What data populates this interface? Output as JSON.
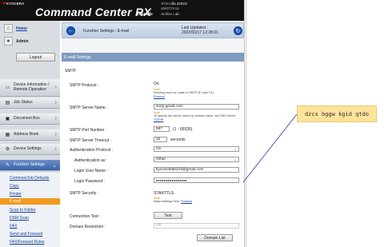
{
  "brand": {
    "name": "KYOCERA",
    "app": "Command Center RX",
    "series": "TASKalfa"
  },
  "device": {
    "model_label": "Model :",
    "model": "TASKalfa 3252ci",
    "host_label": "Host Name :",
    "host": "KM27C616",
    "location_label": "Location :",
    "location": "Hotline Lab"
  },
  "sidebar": {
    "home": "Home",
    "admin": "Admin",
    "logout": "Logout",
    "items": [
      {
        "label": "Device Information / Remote Operation"
      },
      {
        "label": "Job Status"
      },
      {
        "label": "Document Box"
      },
      {
        "label": "Address Book"
      },
      {
        "label": "Device Settings"
      },
      {
        "label": "Function Settings"
      }
    ],
    "sub": [
      "Common/Job Defaults",
      "Copy",
      "Printer",
      "E-mail",
      "Scan to Folder",
      "DSM Scan",
      "FAX",
      "Send and Forward",
      "FAX/Forward Rules"
    ]
  },
  "header": {
    "title": "Function Settings : E-mail",
    "updated_label": "Last Updated :",
    "updated": "2022/03/17 12:28:01"
  },
  "section": "E-mail Settings",
  "form": {
    "group": "SMTP",
    "smtp_protocol": {
      "label": "SMTP Protocol :",
      "value": "On",
      "note_tag": "Note",
      "note": "Sending must be made in SMTP (E-mail TX).",
      "note_link": "Protocol"
    },
    "server_name": {
      "label": "SMTP Server Name :",
      "value": "smtp.gmail.com",
      "note_tag": "Note",
      "note": "To specify the server name by domain name, set DNS server.",
      "note_link": "TCP/IP"
    },
    "port": {
      "label": "SMTP Port Number :",
      "value": "587",
      "range": "(1 - 65535)"
    },
    "timeout": {
      "label": "SMTP Server Timeout :",
      "value": "10",
      "unit": "seconds"
    },
    "auth_protocol": {
      "label": "Authentication Protocol :",
      "value": "On"
    },
    "auth_as": {
      "label": "Authentication as :",
      "value": "Other"
    },
    "login_user": {
      "label": "Login User Name :",
      "value": "kyocerafabt123@gmail.com"
    },
    "login_password": {
      "label": "Login Password :",
      "value": "●●●●●●●●●●●●●●●●"
    },
    "security": {
      "label": "SMTP Security :",
      "value": "STARTTLS",
      "note_tag": "Note",
      "note": "Make settings here.",
      "note_link": "Protocol"
    },
    "connection_test": {
      "label": "Connection Test :",
      "button": "Test"
    },
    "domain_restriction": {
      "label": "Domain Restriction :",
      "value": "Off",
      "button": "Domain List"
    }
  },
  "callout": {
    "text": "dzcs bggw kgid qtdo"
  }
}
